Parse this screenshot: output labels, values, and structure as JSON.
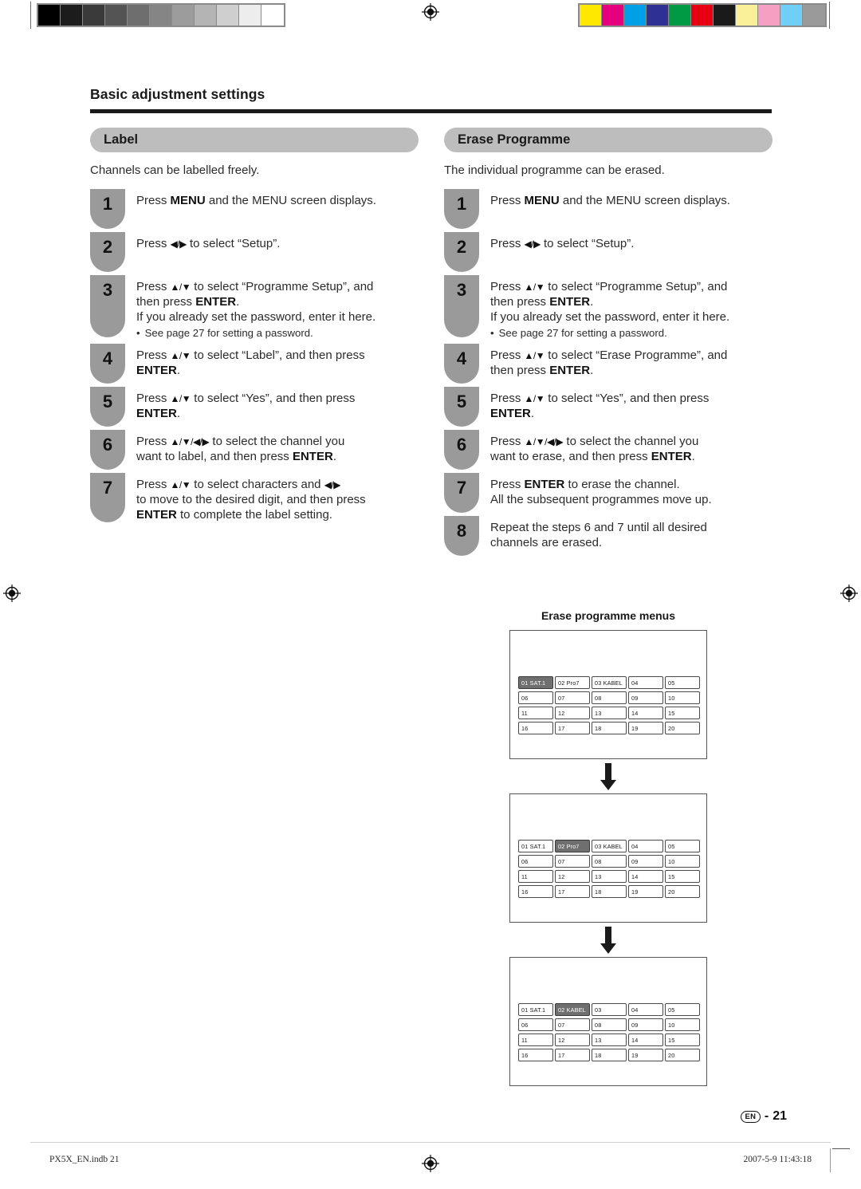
{
  "document": {
    "running_head": "Basic adjustment settings",
    "page_label": "21",
    "language_badge": "EN",
    "page_separator": "-"
  },
  "calibration": {
    "grayscale_swatches": [
      "#000000",
      "#1c1c1c",
      "#3a3a3a",
      "#545454",
      "#6e6e6e",
      "#858585",
      "#9c9c9c",
      "#b4b4b4",
      "#cfcfcf",
      "#ededed",
      "#ffffff"
    ],
    "color_swatches": [
      "#ffe800",
      "#e5007d",
      "#00a0e9",
      "#2e3192",
      "#009944",
      "#e60012",
      "#1a1a1a",
      "#fbf09a",
      "#f5a0c3",
      "#6fcff6",
      "#9a9a9a"
    ]
  },
  "left_column": {
    "section_title": "Label",
    "intro": "Channels can be labelled freely.",
    "steps": [
      {
        "number": "1",
        "lines": [
          [
            {
              "t": "Press "
            },
            {
              "t": "MENU",
              "b": true
            },
            {
              "t": " and the MENU screen displays."
            }
          ]
        ]
      },
      {
        "number": "2",
        "lines": [
          [
            {
              "t": "Press "
            },
            {
              "t": "◀/▶",
              "a": true
            },
            {
              "t": " to select “Setup”."
            }
          ]
        ]
      },
      {
        "number": "3",
        "size": "tall",
        "lines": [
          [
            {
              "t": "Press "
            },
            {
              "t": "▲/▼",
              "a": true
            },
            {
              "t": " to select “Programme Setup”, and"
            }
          ],
          [
            {
              "t": "then press "
            },
            {
              "t": "ENTER",
              "b": true
            },
            {
              "t": "."
            }
          ],
          [
            {
              "t": "If you already set the password, enter it here."
            }
          ]
        ],
        "note": "See page 27 for setting a password."
      },
      {
        "number": "4",
        "lines": [
          [
            {
              "t": "Press "
            },
            {
              "t": "▲/▼",
              "a": true
            },
            {
              "t": " to select “Label”, and then press"
            }
          ],
          [
            {
              "t": "ENTER",
              "b": true
            },
            {
              "t": "."
            }
          ]
        ]
      },
      {
        "number": "5",
        "lines": [
          [
            {
              "t": "Press "
            },
            {
              "t": "▲/▼",
              "a": true
            },
            {
              "t": " to select “Yes”, and then press"
            }
          ],
          [
            {
              "t": "ENTER",
              "b": true
            },
            {
              "t": "."
            }
          ]
        ]
      },
      {
        "number": "6",
        "lines": [
          [
            {
              "t": "Press "
            },
            {
              "t": "▲/▼/◀/▶",
              "a": true
            },
            {
              "t": " to select the channel you"
            }
          ],
          [
            {
              "t": "want to label, and then press "
            },
            {
              "t": "ENTER",
              "b": true
            },
            {
              "t": "."
            }
          ]
        ]
      },
      {
        "number": "7",
        "size": "tall2",
        "lines": [
          [
            {
              "t": "Press "
            },
            {
              "t": "▲/▼",
              "a": true
            },
            {
              "t": " to select characters and "
            },
            {
              "t": "◀/▶",
              "a": true
            }
          ],
          [
            {
              "t": "to move to the desired digit, and then press"
            }
          ],
          [
            {
              "t": "ENTER",
              "b": true
            },
            {
              "t": " to complete the label setting."
            }
          ]
        ]
      }
    ]
  },
  "right_column": {
    "section_title": "Erase Programme",
    "intro": "The individual programme can be erased.",
    "steps": [
      {
        "number": "1",
        "lines": [
          [
            {
              "t": "Press "
            },
            {
              "t": "MENU",
              "b": true
            },
            {
              "t": " and the MENU screen displays."
            }
          ]
        ]
      },
      {
        "number": "2",
        "lines": [
          [
            {
              "t": "Press "
            },
            {
              "t": "◀/▶",
              "a": true
            },
            {
              "t": " to select “Setup”."
            }
          ]
        ]
      },
      {
        "number": "3",
        "size": "tall",
        "lines": [
          [
            {
              "t": "Press "
            },
            {
              "t": "▲/▼",
              "a": true
            },
            {
              "t": " to select “Programme Setup”, and"
            }
          ],
          [
            {
              "t": "then press "
            },
            {
              "t": "ENTER",
              "b": true
            },
            {
              "t": "."
            }
          ],
          [
            {
              "t": "If you already set the password, enter it here."
            }
          ]
        ],
        "note": "See page 27 for setting a password."
      },
      {
        "number": "4",
        "lines": [
          [
            {
              "t": "Press "
            },
            {
              "t": "▲/▼",
              "a": true
            },
            {
              "t": " to select “Erase Programme”, and"
            }
          ],
          [
            {
              "t": "then press "
            },
            {
              "t": "ENTER",
              "b": true
            },
            {
              "t": "."
            }
          ]
        ]
      },
      {
        "number": "5",
        "lines": [
          [
            {
              "t": "Press "
            },
            {
              "t": "▲/▼",
              "a": true
            },
            {
              "t": " to select “Yes”, and then press"
            }
          ],
          [
            {
              "t": "ENTER",
              "b": true
            },
            {
              "t": "."
            }
          ]
        ]
      },
      {
        "number": "6",
        "lines": [
          [
            {
              "t": "Press "
            },
            {
              "t": "▲/▼/◀/▶",
              "a": true
            },
            {
              "t": " to select the channel you"
            }
          ],
          [
            {
              "t": "want to erase, and then press "
            },
            {
              "t": "ENTER",
              "b": true
            },
            {
              "t": "."
            }
          ]
        ]
      },
      {
        "number": "7",
        "lines": [
          [
            {
              "t": "Press "
            },
            {
              "t": "ENTER",
              "b": true
            },
            {
              "t": " to erase the channel."
            }
          ],
          [
            {
              "t": "All the subsequent programmes move up."
            }
          ]
        ]
      },
      {
        "number": "8",
        "lines": [
          [
            {
              "t": "Repeat the steps 6 and 7 until all desired"
            }
          ],
          [
            {
              "t": "channels are erased."
            }
          ]
        ]
      }
    ]
  },
  "figure": {
    "caption": "Erase programme menus",
    "panels": [
      {
        "selected_index": 0,
        "cells": [
          "01  SAT.1",
          "02  Pro7",
          "03  KABEL",
          "04",
          "05",
          "06",
          "07",
          "08",
          "09",
          "10",
          "11",
          "12",
          "13",
          "14",
          "15",
          "16",
          "17",
          "18",
          "19",
          "20"
        ]
      },
      {
        "selected_index": 1,
        "cells": [
          "01  SAT.1",
          "02  Pro7",
          "03  KABEL",
          "04",
          "05",
          "06",
          "07",
          "08",
          "09",
          "10",
          "11",
          "12",
          "13",
          "14",
          "15",
          "16",
          "17",
          "18",
          "19",
          "20"
        ]
      },
      {
        "selected_index": 1,
        "cells": [
          "01  SAT.1",
          "02  KABEL",
          "03",
          "04",
          "05",
          "06",
          "07",
          "08",
          "09",
          "10",
          "11",
          "12",
          "13",
          "14",
          "15",
          "16",
          "17",
          "18",
          "19",
          "20"
        ]
      }
    ]
  },
  "footer": {
    "left": "PX5X_EN.indb   21",
    "right": "2007-5-9   11:43:18"
  }
}
